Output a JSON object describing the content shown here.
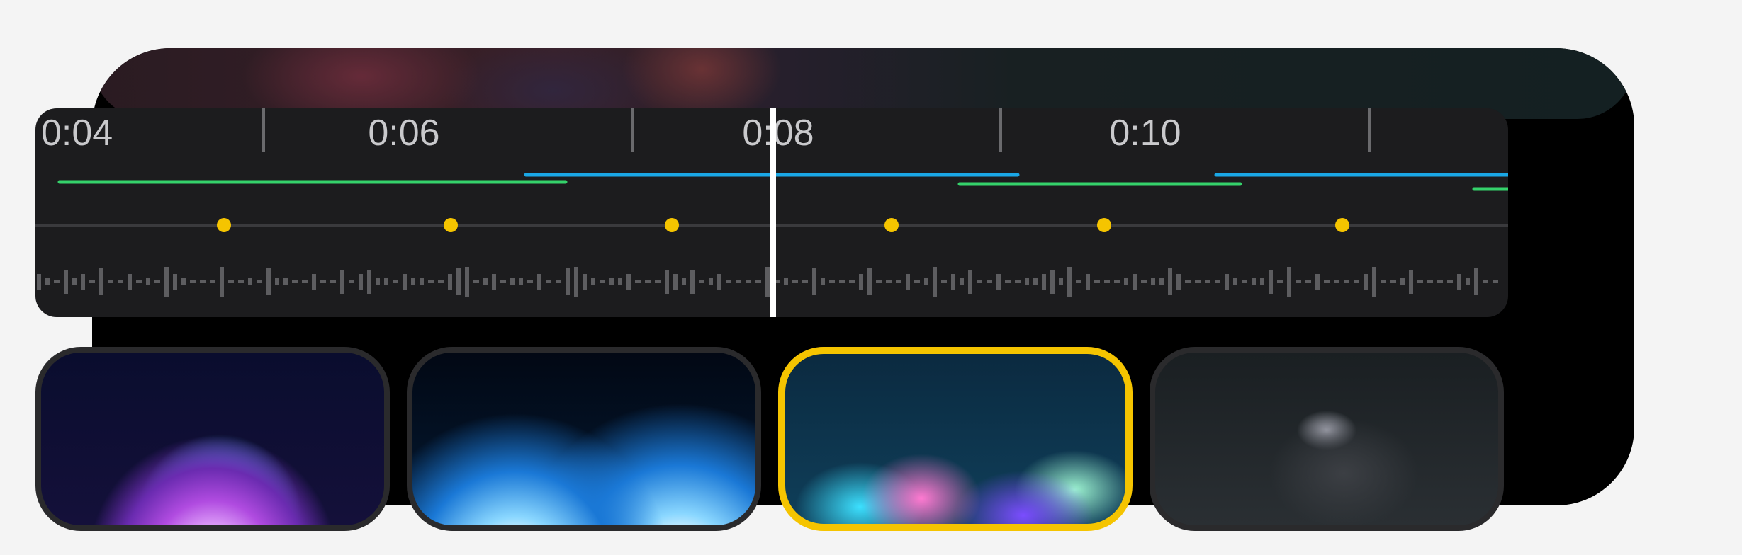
{
  "timeline": {
    "time_labels": [
      "0:04",
      "0:06",
      "0:08",
      "0:10"
    ],
    "track_colors": {
      "green": "#35d26b",
      "blue": "#1aa7e6",
      "keyframe": "#f5c400",
      "waveform": "#5d5d60"
    },
    "playhead_time": "0:08"
  },
  "thumbnails": [
    {
      "name": "purple-fractal-burst",
      "selected": false
    },
    {
      "name": "blue-light-orbs",
      "selected": false
    },
    {
      "name": "iridescent-fluid-wave",
      "selected": true
    },
    {
      "name": "dark-glass-smoke",
      "selected": false
    }
  ]
}
